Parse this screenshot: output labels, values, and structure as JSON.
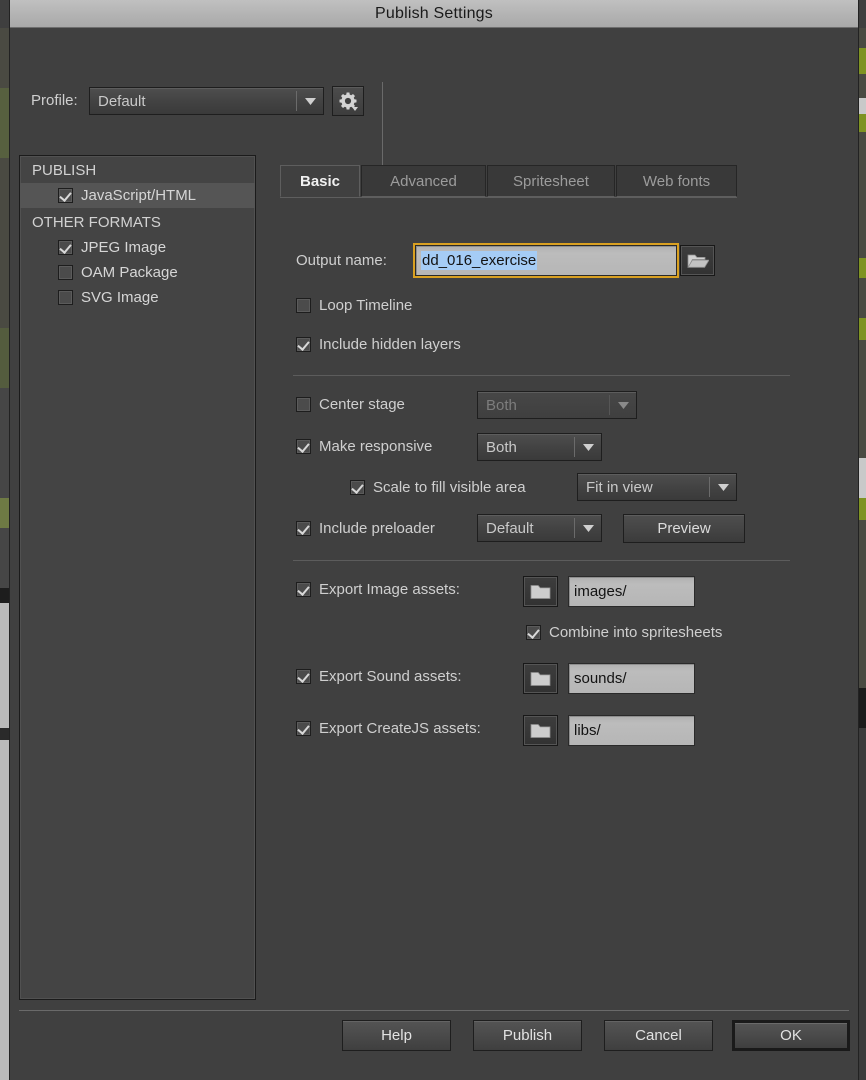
{
  "window": {
    "title": "Publish Settings"
  },
  "profile": {
    "label": "Profile:",
    "value": "Default",
    "gear_icon": "gear-icon"
  },
  "sidebar": {
    "groups": [
      {
        "title": "PUBLISH",
        "items": [
          {
            "label": "JavaScript/HTML",
            "checked": true,
            "selected": true
          }
        ]
      },
      {
        "title": "OTHER FORMATS",
        "items": [
          {
            "label": "JPEG Image",
            "checked": true,
            "selected": false
          },
          {
            "label": "OAM Package",
            "checked": false,
            "selected": false
          },
          {
            "label": "SVG Image",
            "checked": false,
            "selected": false
          }
        ]
      }
    ]
  },
  "tabs": [
    {
      "label": "Basic",
      "active": true
    },
    {
      "label": "Advanced",
      "active": false
    },
    {
      "label": "Spritesheet",
      "active": false
    },
    {
      "label": "Web fonts",
      "active": false
    }
  ],
  "basic": {
    "output_name_label": "Output name:",
    "output_name_value": "dd_016_exercise",
    "output_name_browse_icon": "folder-open-icon",
    "loop_timeline": {
      "label": "Loop Timeline",
      "checked": false
    },
    "include_hidden_layers": {
      "label": "Include hidden layers",
      "checked": true
    },
    "center_stage": {
      "label": "Center stage",
      "checked": false,
      "value": "Both",
      "disabled": true
    },
    "make_responsive": {
      "label": "Make responsive",
      "checked": true,
      "value": "Both"
    },
    "scale_to_fill": {
      "label": "Scale to fill visible area",
      "checked": true,
      "value": "Fit in view"
    },
    "include_preloader": {
      "label": "Include preloader",
      "checked": true,
      "value": "Default",
      "preview_button": "Preview"
    },
    "export_image_assets": {
      "label": "Export Image assets:",
      "checked": true,
      "folder_icon": "folder-icon",
      "path": "images/"
    },
    "combine_into_spritesheets": {
      "label": "Combine into spritesheets",
      "checked": true
    },
    "export_sound_assets": {
      "label": "Export Sound assets:",
      "checked": true,
      "folder_icon": "folder-icon",
      "path": "sounds/"
    },
    "export_createjs_assets": {
      "label": "Export CreateJS assets:",
      "checked": true,
      "folder_icon": "folder-icon",
      "path": "libs/"
    }
  },
  "footer": {
    "help": "Help",
    "publish": "Publish",
    "cancel": "Cancel",
    "ok": "OK"
  },
  "colors": {
    "dialog_bg": "#404040",
    "titlebar_bg": "#b3b3b3",
    "sidebar_bg": "#444444",
    "selection_highlight": "#a5ccf5",
    "focus_ring": "#d9a021",
    "text_primary": "#cfcfcf",
    "field_bg": "#b6b6b6"
  }
}
